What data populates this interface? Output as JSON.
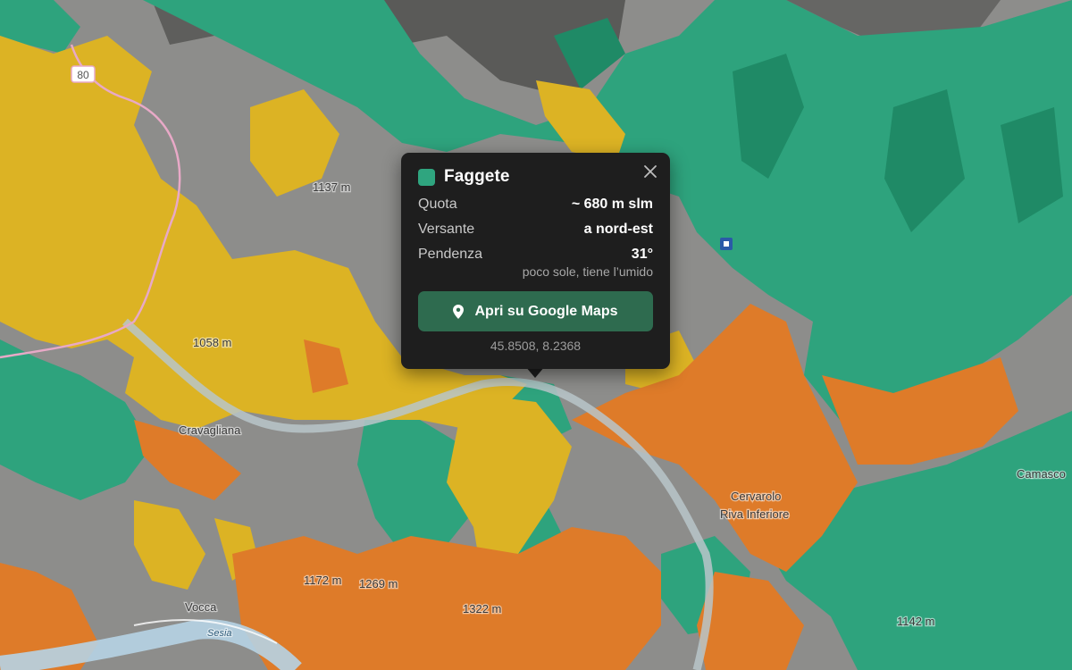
{
  "colors": {
    "faggete": "#2fa57f",
    "faggete_dark": "#1f8a67",
    "castagneti": "#dfb523",
    "querceti": "#e07c2a",
    "roccia": "#8e8e8c",
    "popup_bg": "#1e1e1e",
    "button_bg": "#2e6b4f"
  },
  "map": {
    "place_labels": [
      "Cravagliana",
      "Vocca",
      "Cervarolo",
      "Riva Inferiore",
      "Camasco",
      "Sesia"
    ],
    "elevation_labels": [
      "1137 m",
      "1058 m",
      "1269 m",
      "1322 m",
      "1172 m",
      "1142 m"
    ],
    "road_number": "80"
  },
  "popup": {
    "title": "Faggete",
    "swatch_icon": "green-square-icon",
    "close_icon": "close-icon",
    "rows": [
      {
        "label": "Quota",
        "value": "~ 680 m slm"
      },
      {
        "label": "Versante",
        "value": "a nord-est"
      },
      {
        "label": "Pendenza",
        "value": "31°"
      }
    ],
    "note": "poco sole, tiene l’umido",
    "button_label": "Apri su Google Maps",
    "button_icon": "map-pin-icon",
    "coordinates": "45.8508, 8.2368"
  }
}
